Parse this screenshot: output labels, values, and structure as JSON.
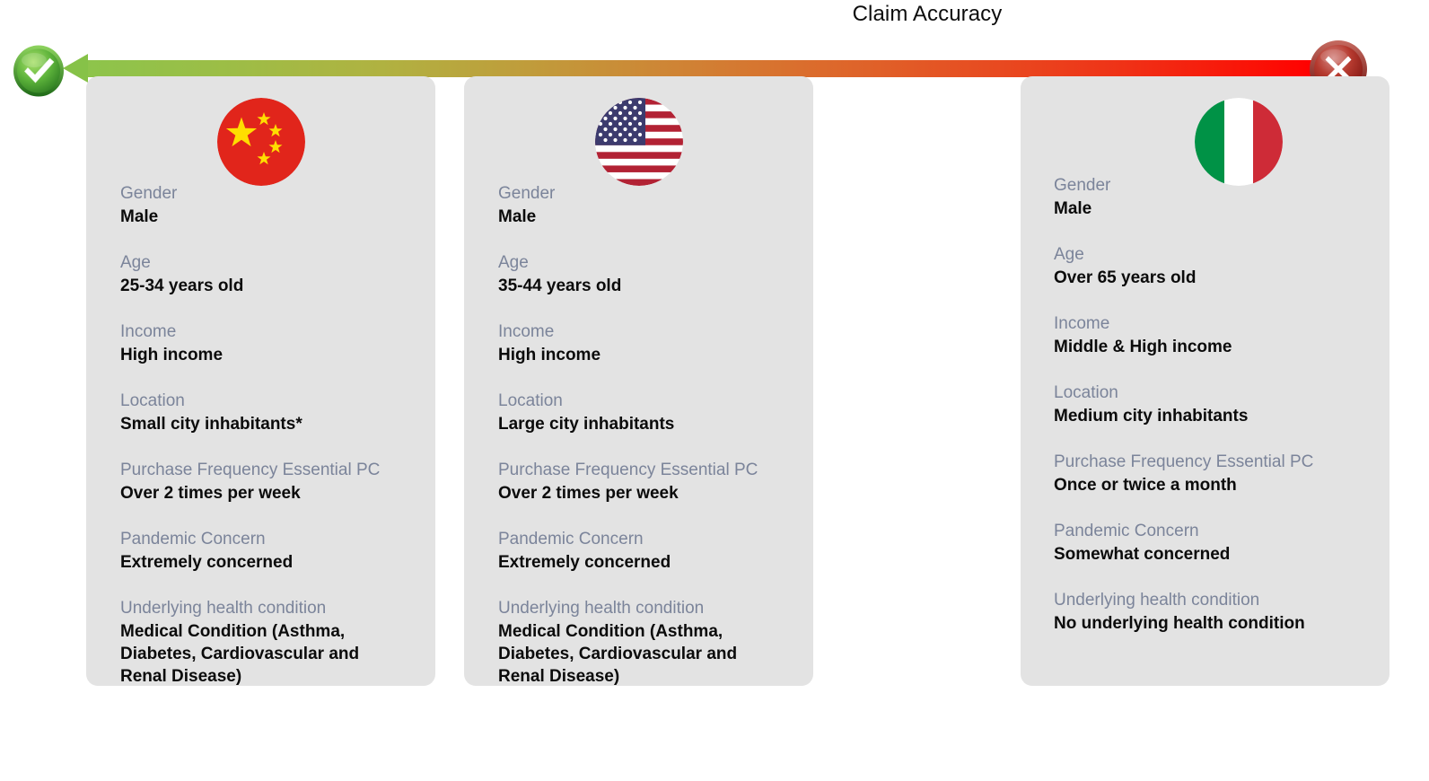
{
  "scale": {
    "title": "Claim Accuracy",
    "left_icon": "check-circle-icon",
    "right_icon": "x-circle-icon",
    "left_color": "#86c248",
    "right_color": "#ff0000",
    "direction": "left-pointing-arrow"
  },
  "cards": [
    {
      "flag": "china-flag-icon",
      "country": "China",
      "fields": [
        {
          "label": "Gender",
          "value": "Male"
        },
        {
          "label": "Age",
          "value": "25-34 years old"
        },
        {
          "label": "Income",
          "value": "High income"
        },
        {
          "label": "Location",
          "value": "Small city inhabitants*"
        },
        {
          "label": "Purchase Frequency Essential PC",
          "value": "Over 2 times per week"
        },
        {
          "label": "Pandemic Concern",
          "value": "Extremely concerned"
        },
        {
          "label": "Underlying health condition",
          "value": "Medical Condition (Asthma, Diabetes, Cardiovascular and Renal Disease)"
        }
      ]
    },
    {
      "flag": "usa-flag-icon",
      "country": "United States",
      "fields": [
        {
          "label": "Gender",
          "value": "Male"
        },
        {
          "label": "Age",
          "value": "35-44 years old"
        },
        {
          "label": "Income",
          "value": "High income"
        },
        {
          "label": "Location",
          "value": "Large city inhabitants"
        },
        {
          "label": "Purchase Frequency Essential PC",
          "value": "Over 2 times per week"
        },
        {
          "label": "Pandemic Concern",
          "value": "Extremely concerned"
        },
        {
          "label": "Underlying health condition",
          "value": "Medical Condition (Asthma, Diabetes, Cardiovascular and Renal Disease)"
        }
      ]
    },
    {
      "flag": "italy-flag-icon",
      "country": "Italy",
      "fields": [
        {
          "label": "Gender",
          "value": "Male"
        },
        {
          "label": "Age",
          "value": "Over 65 years old"
        },
        {
          "label": "Income",
          "value": "Middle & High income"
        },
        {
          "label": "Location",
          "value": "Medium city inhabitants"
        },
        {
          "label": "Purchase Frequency Essential PC",
          "value": "Once or twice a month"
        },
        {
          "label": "Pandemic Concern",
          "value": "Somewhat concerned"
        },
        {
          "label": "Underlying health condition",
          "value": "No underlying health condition"
        }
      ]
    }
  ],
  "colors": {
    "card_bg": "#e3e3e3",
    "label": "#7b849a",
    "value": "#0b0b0b",
    "page_bg": "#ffffff"
  }
}
